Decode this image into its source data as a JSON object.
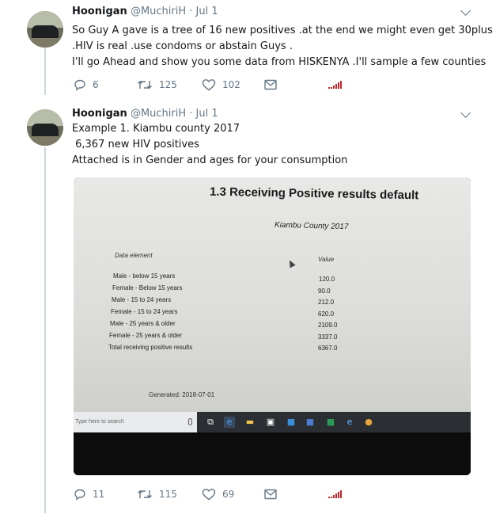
{
  "tweets": [
    {
      "name": "Hoonigan",
      "handle": "@MuchiriH",
      "date": "· Jul 1",
      "lines": [
        "So Guy A gave is a tree of 16 new positives .at the end we might even get 30plus",
        ".HIV is real .use condoms or abstain Guys .",
        "I'll go Ahead and show you some data from HISKENYA .I'll sample a few counties"
      ],
      "replies": "6",
      "retweets": "125",
      "likes": "102"
    },
    {
      "name": "Hoonigan",
      "handle": "@MuchiriH",
      "date": "· Jul 1",
      "lines": [
        "Example 1. Kiambu county 2017",
        " 6,367 new HIV positives",
        "Attached is in Gender and ages for your consumption"
      ],
      "replies": "11",
      "retweets": "115",
      "likes": "69"
    }
  ],
  "media": {
    "title": "1.3 Receiving Positive results default",
    "subtitle": "Kiambu County 2017",
    "col_element": "Data element",
    "col_value": "Value",
    "rows": [
      {
        "label": "Male - below 15 years",
        "value": "120.0"
      },
      {
        "label": "Female - Below 15 years",
        "value": "90.0"
      },
      {
        "label": "Male - 15 to 24 years",
        "value": "212.0"
      },
      {
        "label": "Female - 15 to 24 years",
        "value": "620.0"
      },
      {
        "label": "Male - 25 years & older",
        "value": "2109.0"
      },
      {
        "label": "Female - 25 years & older",
        "value": "3337.0"
      },
      {
        "label": "Total receiving positive results",
        "value": "6367.0"
      }
    ],
    "generated": "Generated: 2018-07-01",
    "taskbar_search": "Type here to search"
  },
  "icons": {
    "reply": "reply-icon",
    "retweet": "retweet-icon",
    "like": "heart-icon",
    "message": "envelope-icon",
    "analytics": "analytics-icon",
    "caret": "chevron-down-icon"
  },
  "colors": {
    "text": "#14171a",
    "muted": "#657786",
    "thread_line": "#ccd6dd",
    "analytics": "#c1272d"
  }
}
